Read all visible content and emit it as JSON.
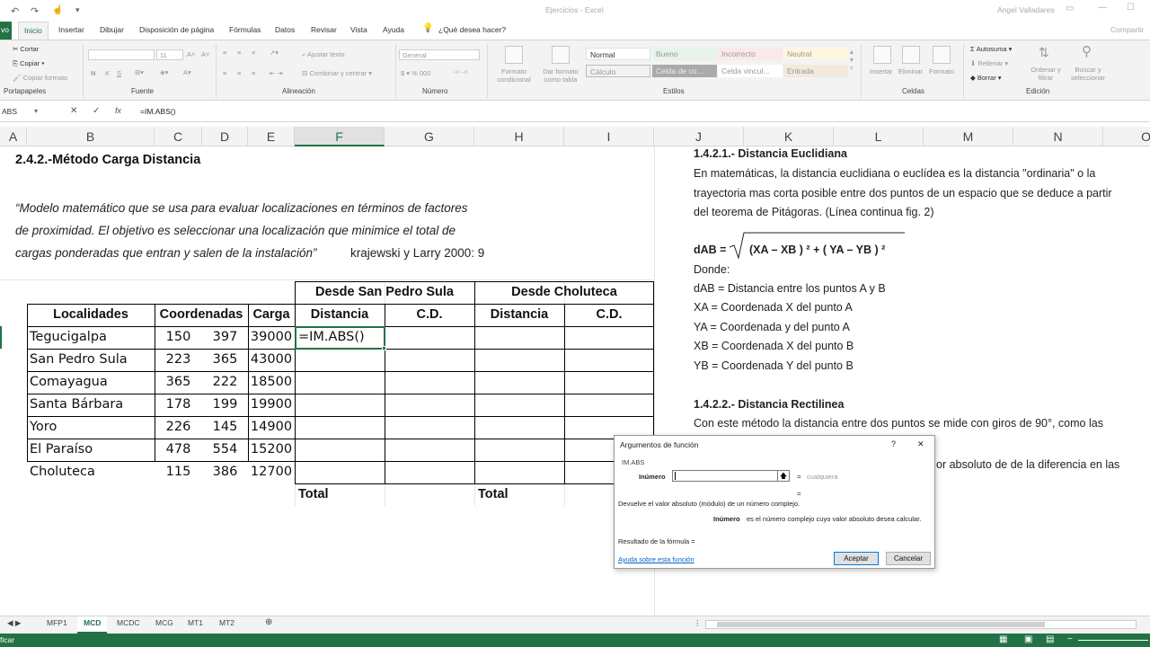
{
  "window": {
    "title": "Ejercicios - Excel",
    "user": "Angel Valladares"
  },
  "ribbon_tabs": [
    "Archivo",
    "Inicio",
    "Insertar",
    "Dibujar",
    "Disposición de página",
    "Fórmulas",
    "Datos",
    "Revisar",
    "Vista",
    "Ayuda"
  ],
  "tell_me": "¿Qué desea hacer?",
  "share": "Compartir",
  "ribbon": {
    "clipboard": {
      "cut": "Cortar",
      "copy": "Copiar",
      "format_painter": "Copiar formato",
      "label": "Portapapeles"
    },
    "font": {
      "size": "11",
      "label": "Fuente",
      "bold": "N",
      "italic": "K",
      "underline": "S"
    },
    "alignment": {
      "wrap": "Ajustar texto",
      "merge": "Combinar y centrar",
      "label": "Alineación"
    },
    "number": {
      "format": "General",
      "label": "Número"
    },
    "styles": {
      "conditional": "Formato condicional",
      "as_table": "Dar formato como tabla",
      "label": "Estilos",
      "cells": [
        "Normal",
        "Bueno",
        "Incorrecto",
        "Neutral",
        "Cálculo",
        "Celda de co...",
        "Celda vincul...",
        "Entrada"
      ]
    },
    "cells": {
      "insert": "Insertar",
      "delete": "Eliminar",
      "format": "Formato",
      "label": "Celdas"
    },
    "editing": {
      "autosum": "Autosuma",
      "fill": "Rellenar",
      "clear": "Borrar",
      "sort": "Ordenar y filtrar",
      "find": "Buscar y seleccionar",
      "label": "Edición"
    }
  },
  "formula_bar": {
    "name_box": "ABS",
    "formula": "=IM.ABS()"
  },
  "columns": [
    "A",
    "B",
    "C",
    "D",
    "E",
    "F",
    "G",
    "H",
    "I",
    "J",
    "K",
    "L",
    "M",
    "N",
    "O"
  ],
  "sheet": {
    "title": "2.4.2.-Método Carga Distancia",
    "quote_lines": [
      "“Modelo matemático que se usa para evaluar localizaciones en términos de factores",
      "de proximidad. El objetivo es seleccionar una localización que minimice el total de",
      "cargas ponderadas que entran y salen de la instalación”"
    ],
    "citation": "krajewski y Larry 2000: 9",
    "group_headers": [
      "Desde San Pedro Sula",
      "Desde Choluteca"
    ],
    "headers": [
      "Localidades",
      "Coordenadas",
      "Carga",
      "Distancia",
      "C.D.",
      "Distancia",
      "C.D."
    ],
    "rows": [
      {
        "name": "Tegucigalpa",
        "x": "150",
        "y": "397",
        "carga": "39000"
      },
      {
        "name": "San Pedro Sula",
        "x": "223",
        "y": "365",
        "carga": "43000"
      },
      {
        "name": "Comayagua",
        "x": "365",
        "y": "222",
        "carga": "18500"
      },
      {
        "name": "Santa Bárbara",
        "x": "178",
        "y": "199",
        "carga": "19900"
      },
      {
        "name": "Yoro",
        "x": "226",
        "y": "145",
        "carga": "14900"
      },
      {
        "name": "El Paraíso",
        "x": "478",
        "y": "554",
        "carga": "15200"
      },
      {
        "name": "Choluteca",
        "x": "115",
        "y": "386",
        "carga": "12700"
      }
    ],
    "active_cell_value": "=IM.ABS()",
    "total_label": "Total",
    "total_label_2": "Total"
  },
  "notes": {
    "title1": "1.4.2.1.- Distancia Euclidiana",
    "para1": [
      "En matemáticas, la distancia euclidiana o euclídea es la distancia \"ordinaria\" o la",
      "trayectoria mas corta posible entre dos puntos de un espacio que se deduce a partir",
      "del teorema de Pitágoras. (Línea continua fig. 2)"
    ],
    "formula_lhs": "dAB  =",
    "formula": "(XA – XB ) ²   +  ( YA – YB ) ²",
    "donde": "Donde:",
    "defs": [
      "dAB = Distancia entre los puntos A y B",
      "XA = Coordenada X del punto A",
      "YA = Coordenada y del punto A",
      "XB =  Coordenada X del punto B",
      "YB  = Coordenada Y del punto B"
    ],
    "title2": "1.4.2.2.- Distancia Rectilinea",
    "para2_line1": "Con este método la distancia entre dos puntos se mide con giros de 90°, como las",
    "para2_line3": "or absoluto de de la diferencia en las"
  },
  "dialog": {
    "title": "Argumentos de función",
    "help": "?",
    "close": "✕",
    "function_name": "IM.ABS",
    "arg_label": "Inúmero",
    "arg_value": "",
    "arg_result": "cualquiera",
    "eq1": "=",
    "eq2": "=",
    "description": "Devuelve el valor absoluto (módulo) de un número complejo.",
    "arg_help_name": "Inúmero",
    "arg_help": "es el número complejo cuyo valor absoluto desea calcular.",
    "result_label": "Resultado de la fórmula =",
    "help_link": "Ayuda sobre esta función",
    "ok": "Aceptar",
    "cancel": "Cancelar"
  },
  "sheet_tabs": [
    "MFP1",
    "MCD",
    "MCDC",
    "MCG",
    "MT1",
    "MT2"
  ],
  "active_tab": "MCD",
  "status": {
    "mode": "ficar"
  }
}
